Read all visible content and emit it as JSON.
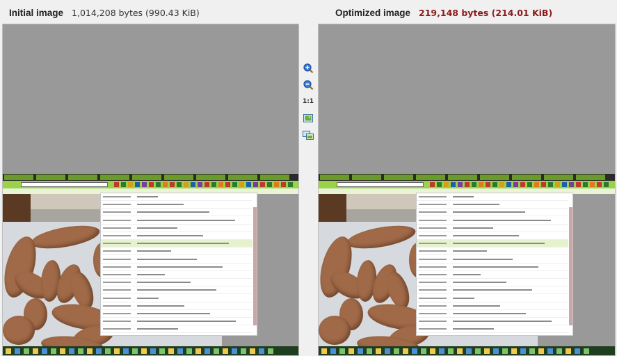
{
  "initial": {
    "title": "Initial image",
    "size_text": "1,014,208 bytes (990.43 KiB)"
  },
  "optimized": {
    "title": "Optimized image",
    "size_text": "219,148 bytes (214.01 KiB)"
  },
  "toolbar": {
    "zoom_in_icon": "zoom-in-icon",
    "zoom_out_icon": "zoom-out-icon",
    "actual_size_label": "1:1",
    "fit_icon": "fit-to-window-icon",
    "compare_icon": "compare-view-icon"
  },
  "colors": {
    "optimized_size": "#8b1a1a",
    "pane_background": "#999999",
    "browser_green": "#9ad24a"
  }
}
